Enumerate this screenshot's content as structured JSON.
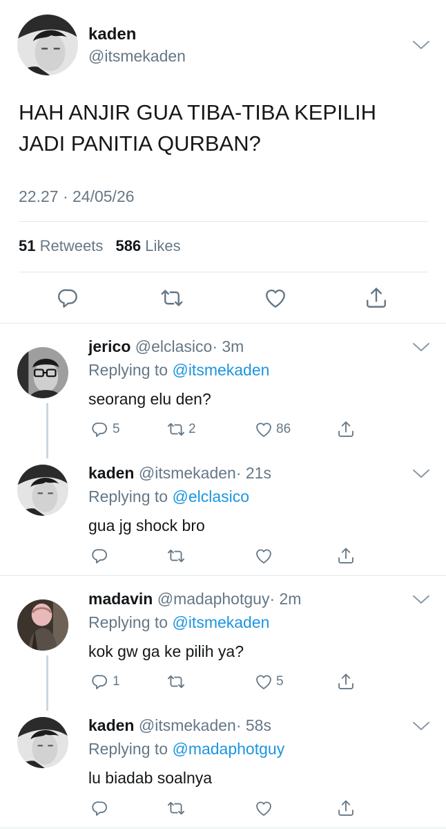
{
  "tweet": {
    "name": "kaden",
    "handle": "@itsmekaden",
    "text_line1": "HAH ANJIR GUA TIBA-TIBA KEPILIH",
    "text_line2": "JADI PANITIA QURBAN?",
    "timestamp": "22.27 · 24/05/26",
    "retweets_count": "51",
    "retweets_label": "Retweets",
    "likes_count": "586",
    "likes_label": "Likes"
  },
  "replies": [
    {
      "name": "jerico",
      "handle": "@elclasico",
      "time": "· 3m",
      "replying_prefix": "Replying to",
      "replying_to": "@itsmekaden",
      "text": "seorang elu den?",
      "reply_count": "5",
      "retweet_count": "2",
      "like_count": "86"
    },
    {
      "name": "kaden",
      "handle": "@itsmekaden",
      "time": "· 21s",
      "replying_prefix": "Replying to",
      "replying_to": "@elclasico",
      "text": "gua jg shock bro",
      "reply_count": "",
      "retweet_count": "",
      "like_count": ""
    },
    {
      "name": "madavin",
      "handle": "@madaphotguy",
      "time": "· 2m",
      "replying_prefix": "Replying to",
      "replying_to": "@itsmekaden",
      "text": "kok gw ga ke pilih ya?",
      "reply_count": "1",
      "retweet_count": "",
      "like_count": "5"
    },
    {
      "name": "kaden",
      "handle": "@itsmekaden",
      "time": "· 58s",
      "replying_prefix": "Replying to",
      "replying_to": "@madaphotguy",
      "text": "lu biadab soalnya",
      "reply_count": "",
      "retweet_count": "",
      "like_count": ""
    }
  ],
  "colors": {
    "text": "#14171a",
    "secondary": "#657786",
    "link": "#1b95e0",
    "divider": "#e1e8ed",
    "thread": "#ccd6dd"
  },
  "icons": [
    "reply-icon",
    "retweet-icon",
    "like-icon",
    "share-icon",
    "chevron-down-icon"
  ]
}
